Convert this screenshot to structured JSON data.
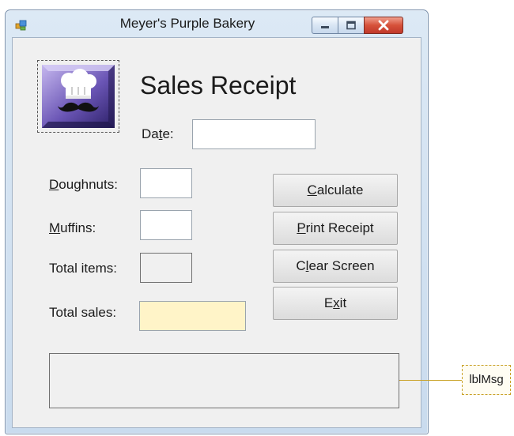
{
  "window": {
    "title": "Meyer's Purple Bakery",
    "icons": {
      "app": "app-icon",
      "minimize": "minimize-icon",
      "maximize": "maximize-icon",
      "close": "close-icon"
    }
  },
  "form": {
    "heading": "Sales Receipt",
    "logo_icon": "chef-hat-mustache-icon",
    "date": {
      "pre": "Da",
      "accel": "t",
      "post": "e:",
      "value": ""
    },
    "doughnuts": {
      "accel": "D",
      "rest": "oughnuts:",
      "value": ""
    },
    "muffins": {
      "accel": "M",
      "rest": "uffins:",
      "value": ""
    },
    "total_items": {
      "label": "Total items:",
      "value": ""
    },
    "total_sales": {
      "label": "Total sales:",
      "value": ""
    },
    "buttons": {
      "calculate": {
        "pre": "",
        "accel": "C",
        "post": "alculate"
      },
      "print": {
        "pre": "",
        "accel": "P",
        "post": "rint Receipt"
      },
      "clear": {
        "pre": "C",
        "accel": "l",
        "post": "ear Screen"
      },
      "exit": {
        "pre": "E",
        "accel": "x",
        "post": "it"
      }
    },
    "message": ""
  },
  "annotation": {
    "label": "lblMsg"
  },
  "colors": {
    "sales_box": "#fff4c8",
    "callout_border": "#c9a227",
    "close_button": "#c0392b"
  }
}
